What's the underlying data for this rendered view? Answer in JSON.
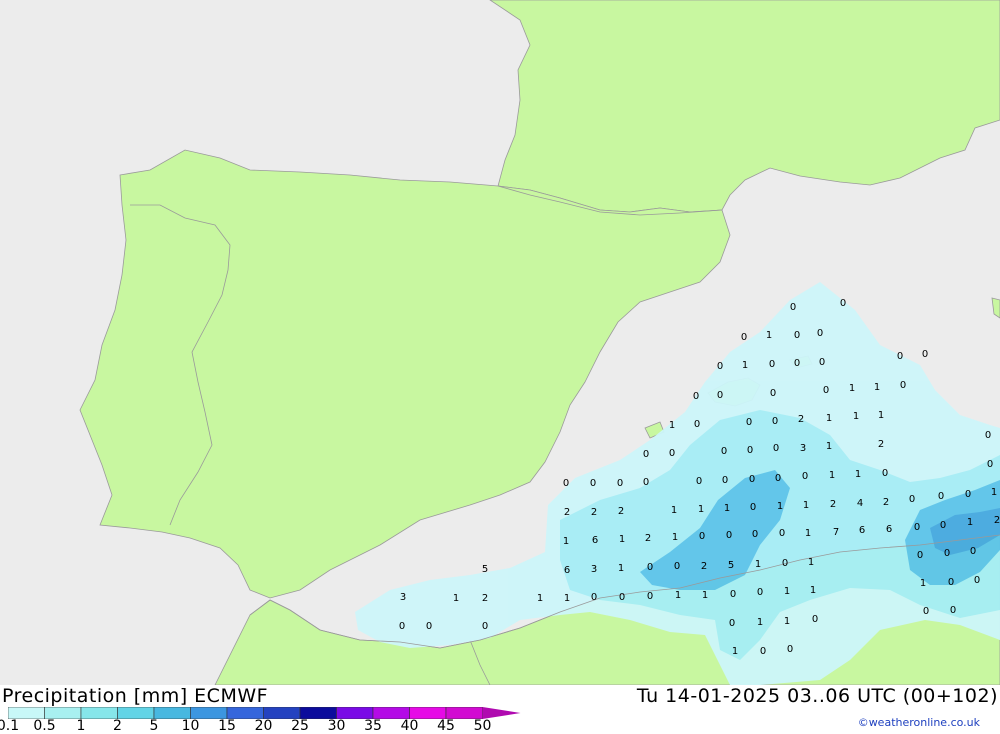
{
  "header": {
    "title_left": "Precipitation [mm] ECMWF",
    "title_right": "Tu 14-01-2025 03..06 UTC (00+102)"
  },
  "legend": {
    "ticks": [
      "0.1",
      "0.5",
      "1",
      "2",
      "5",
      "10",
      "15",
      "20",
      "25",
      "30",
      "35",
      "40",
      "45",
      "50"
    ],
    "colors": [
      "#c8f8f8",
      "#a8f0f0",
      "#86e6ea",
      "#62d4e6",
      "#48b8e0",
      "#3c96e0",
      "#3566dc",
      "#2442c0",
      "#0c0c9c",
      "#7a0ae6",
      "#b40ae6",
      "#e60ae6",
      "#d20ad2",
      "#b00ab0"
    ]
  },
  "credit": "©weatheronline.co.uk",
  "colors": {
    "land": "#c8f7a0",
    "sea": "#ececec",
    "border": "#9a9a9a",
    "precip_light": "#cdf6fa",
    "precip_mid": "#a6eef6",
    "precip_heavy": "#5cc4ea",
    "precip_max": "#45a9e0"
  },
  "precip_values": [
    "0",
    "0",
    "0",
    "1",
    "0",
    "0",
    "0",
    "1",
    "0",
    "0",
    "0",
    "0",
    "0",
    "0",
    "0",
    "0",
    "0",
    "1",
    "1",
    "0",
    "1",
    "0",
    "0",
    "0",
    "2",
    "1",
    "1",
    "1",
    "0",
    "0",
    "0",
    "0",
    "0",
    "0",
    "3",
    "1",
    "2",
    "0",
    "0",
    "0",
    "0",
    "0",
    "0",
    "0",
    "0",
    "0",
    "1",
    "1",
    "0",
    "0",
    "2",
    "2",
    "2",
    "1",
    "1",
    "1",
    "0",
    "1",
    "1",
    "2",
    "4",
    "2",
    "0",
    "0",
    "0",
    "1",
    "1",
    "6",
    "1",
    "2",
    "1",
    "0",
    "0",
    "0",
    "0",
    "1",
    "7",
    "6",
    "6",
    "0",
    "0",
    "1",
    "2",
    "5",
    "6",
    "3",
    "1",
    "0",
    "0",
    "2",
    "5",
    "1",
    "0",
    "1",
    "0",
    "0",
    "0",
    "3",
    "1",
    "2",
    "1",
    "1",
    "0",
    "0",
    "0",
    "1",
    "1",
    "0",
    "0",
    "1",
    "1",
    "1",
    "0",
    "0",
    "0",
    "0",
    "0",
    "0",
    "1",
    "1",
    "0",
    "0",
    "0",
    "1",
    "0",
    "0"
  ]
}
